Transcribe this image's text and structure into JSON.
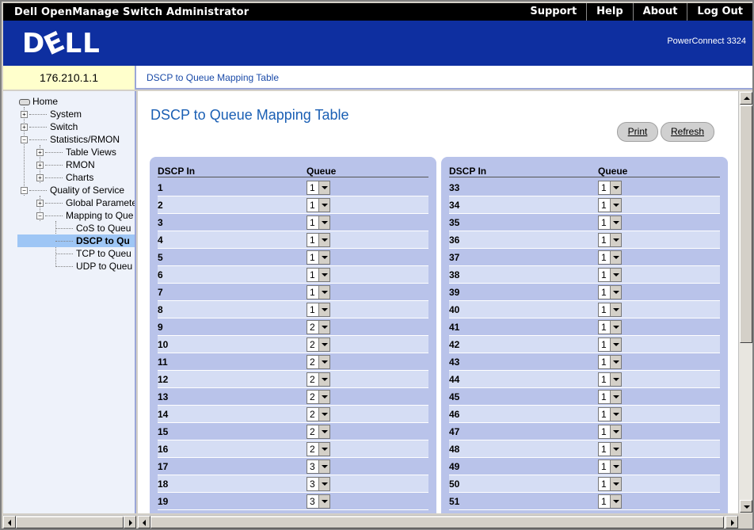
{
  "app": {
    "title": "Dell OpenManage Switch Administrator"
  },
  "topnav": [
    "Support",
    "Help",
    "About",
    "Log Out"
  ],
  "banner": {
    "logo": "DELL",
    "model": "PowerConnect 3324"
  },
  "device": {
    "ip": "176.210.1.1"
  },
  "breadcrumb": "DSCP to Queue Mapping Table",
  "sidebar": {
    "home": "Home",
    "system": "System",
    "switch": "Switch",
    "stats": "Statistics/RMON",
    "table_views": "Table Views",
    "rmon": "RMON",
    "charts": "Charts",
    "qos": "Quality of Service",
    "global_params": "Global Paramete",
    "mapping": "Mapping to Que",
    "cos": "CoS to Queu",
    "dscp": "DSCP to Qu",
    "tcp": "TCP to Queu",
    "udp": "UDP to Queu"
  },
  "page": {
    "title": "DSCP to Queue Mapping Table",
    "print_label": "Print",
    "refresh_label": "Refresh",
    "col_dscp": "DSCP In",
    "col_queue": "Queue"
  },
  "left_table": [
    {
      "dscp": "1",
      "queue": "1"
    },
    {
      "dscp": "2",
      "queue": "1"
    },
    {
      "dscp": "3",
      "queue": "1"
    },
    {
      "dscp": "4",
      "queue": "1"
    },
    {
      "dscp": "5",
      "queue": "1"
    },
    {
      "dscp": "6",
      "queue": "1"
    },
    {
      "dscp": "7",
      "queue": "1"
    },
    {
      "dscp": "8",
      "queue": "1"
    },
    {
      "dscp": "9",
      "queue": "2"
    },
    {
      "dscp": "10",
      "queue": "2"
    },
    {
      "dscp": "11",
      "queue": "2"
    },
    {
      "dscp": "12",
      "queue": "2"
    },
    {
      "dscp": "13",
      "queue": "2"
    },
    {
      "dscp": "14",
      "queue": "2"
    },
    {
      "dscp": "15",
      "queue": "2"
    },
    {
      "dscp": "16",
      "queue": "2"
    },
    {
      "dscp": "17",
      "queue": "3"
    },
    {
      "dscp": "18",
      "queue": "3"
    },
    {
      "dscp": "19",
      "queue": "3"
    }
  ],
  "right_table": [
    {
      "dscp": "33",
      "queue": "1"
    },
    {
      "dscp": "34",
      "queue": "1"
    },
    {
      "dscp": "35",
      "queue": "1"
    },
    {
      "dscp": "36",
      "queue": "1"
    },
    {
      "dscp": "37",
      "queue": "1"
    },
    {
      "dscp": "38",
      "queue": "1"
    },
    {
      "dscp": "39",
      "queue": "1"
    },
    {
      "dscp": "40",
      "queue": "1"
    },
    {
      "dscp": "41",
      "queue": "1"
    },
    {
      "dscp": "42",
      "queue": "1"
    },
    {
      "dscp": "43",
      "queue": "1"
    },
    {
      "dscp": "44",
      "queue": "1"
    },
    {
      "dscp": "45",
      "queue": "1"
    },
    {
      "dscp": "46",
      "queue": "1"
    },
    {
      "dscp": "47",
      "queue": "1"
    },
    {
      "dscp": "48",
      "queue": "1"
    },
    {
      "dscp": "49",
      "queue": "1"
    },
    {
      "dscp": "50",
      "queue": "1"
    },
    {
      "dscp": "51",
      "queue": "1"
    }
  ]
}
